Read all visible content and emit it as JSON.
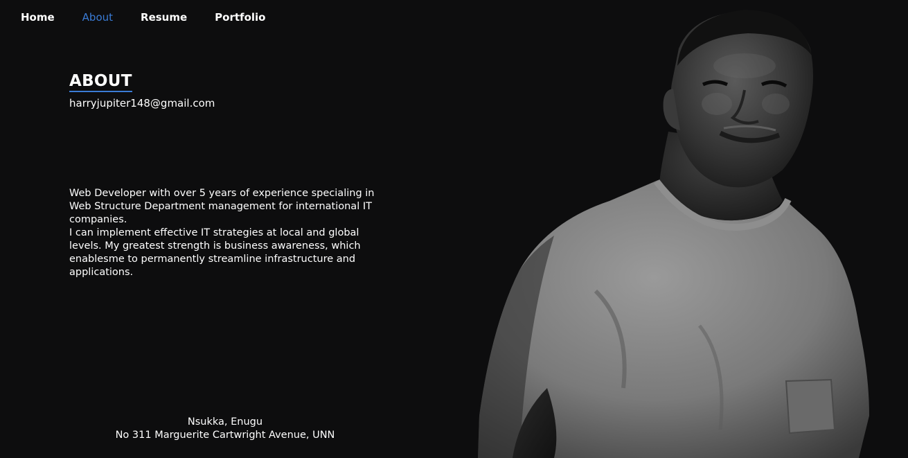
{
  "nav": {
    "items": [
      {
        "label": "Home"
      },
      {
        "label": "About"
      },
      {
        "label": "Resume"
      },
      {
        "label": "Portfolio"
      }
    ]
  },
  "about": {
    "heading": "ABOUT",
    "email": "harryjupiter148@gmail.com",
    "bio_line_1": "Web Developer with over 5 years of experience specialing in Web Structure Department management for international IT companies.",
    "bio_line_2": "I can implement effective IT strategies at local and global levels. My greatest strength is business awareness, which enablesme to permanently streamline infrastructure and applications."
  },
  "address": {
    "city": "Nsukka, Enugu",
    "street": "No 311 Marguerite Cartwright Avenue, UNN"
  },
  "colors": {
    "background": "#0d0d0e",
    "accent": "#3a7bd5",
    "text": "#ffffff"
  }
}
